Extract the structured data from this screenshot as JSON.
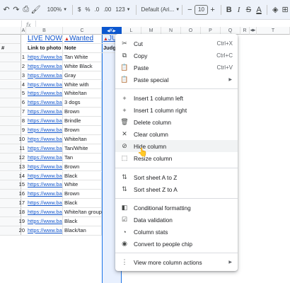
{
  "toolbar": {
    "undo_icon": "undo-icon",
    "redo_icon": "redo-icon",
    "zoom": "100%",
    "currency": "$",
    "percent": "%",
    "dec_dec": ".0",
    "inc_dec": ".00",
    "number_format": "123",
    "font": "Default (Ari...",
    "font_size": "10",
    "bold": "B",
    "italic": "I",
    "strike": "S",
    "text_color": "A"
  },
  "formula": {
    "fx": "fx",
    "value": ""
  },
  "grid": {
    "col_heads": [
      "A",
      "B",
      "C",
      "",
      "K",
      "L",
      "M",
      "N",
      "O",
      "P",
      "Q",
      "R",
      "",
      "T"
    ],
    "header_row": {
      "link": "LIVE NOW",
      "wanted": "Wanted",
      "judging": "JUDGIN"
    },
    "title_row": {
      "hash": "#",
      "link": "Link to photo",
      "note": "Note",
      "judge": "Judg"
    },
    "rows": [
      {
        "n": "1",
        "link": "https://www.back",
        "note": "Tan White"
      },
      {
        "n": "2",
        "link": "https://www.back",
        "note": "White Black"
      },
      {
        "n": "3",
        "link": "https://www.back",
        "note": "Gray"
      },
      {
        "n": "4",
        "link": "https://www.back",
        "note": "White with"
      },
      {
        "n": "5",
        "link": "https://www.back",
        "note": "White/tan"
      },
      {
        "n": "6",
        "link": "https://www.back",
        "note": "3 dogs"
      },
      {
        "n": "7",
        "link": "https://www.back",
        "note": "Brown"
      },
      {
        "n": "8",
        "link": "https://www.back",
        "note": "Brindle"
      },
      {
        "n": "9",
        "link": "https://www.back",
        "note": "Brown"
      },
      {
        "n": "10",
        "link": "https://www.back",
        "note": "White/tan"
      },
      {
        "n": "11",
        "link": "https://www.back",
        "note": "Tan/White"
      },
      {
        "n": "12",
        "link": "https://www.back",
        "note": "Tan"
      },
      {
        "n": "13",
        "link": "https://www.back",
        "note": "Brown"
      },
      {
        "n": "14",
        "link": "https://www.back",
        "note": "Black"
      },
      {
        "n": "15",
        "link": "https://www.back",
        "note": "White"
      },
      {
        "n": "16",
        "link": "https://www.back",
        "note": "Brown"
      },
      {
        "n": "17",
        "link": "https://www.back",
        "note": "Black"
      },
      {
        "n": "18",
        "link": "https://www.back",
        "note": "White/tan group"
      },
      {
        "n": "19",
        "link": "https://www.back",
        "note": "Black"
      },
      {
        "n": "20",
        "link": "https://www.back",
        "note": "Black/tan"
      }
    ]
  },
  "menu": {
    "items": [
      {
        "key": "cut",
        "icon": "✂",
        "label": "Cut",
        "shortcut": "Ctrl+X"
      },
      {
        "key": "copy",
        "icon": "⧉",
        "label": "Copy",
        "shortcut": "Ctrl+C"
      },
      {
        "key": "paste",
        "icon": "📋",
        "label": "Paste",
        "shortcut": "Ctrl+V"
      },
      {
        "key": "paste-special",
        "icon": "📋",
        "label": "Paste special",
        "shortcut": ""
      },
      {
        "key": "insert-left",
        "icon": "+",
        "label": "Insert 1 column left",
        "shortcut": ""
      },
      {
        "key": "insert-right",
        "icon": "+",
        "label": "Insert 1 column right",
        "shortcut": ""
      },
      {
        "key": "delete-column",
        "icon": "🗑",
        "label": "Delete column",
        "shortcut": ""
      },
      {
        "key": "clear-column",
        "icon": "✕",
        "label": "Clear column",
        "shortcut": ""
      },
      {
        "key": "hide-column",
        "icon": "⊘",
        "label": "Hide column",
        "shortcut": ""
      },
      {
        "key": "resize-column",
        "icon": "⬚",
        "label": "Resize column",
        "shortcut": ""
      },
      {
        "key": "sort-a-z",
        "icon": "⇅",
        "label": "Sort sheet A to Z",
        "shortcut": ""
      },
      {
        "key": "sort-z-a",
        "icon": "⇅",
        "label": "Sort sheet Z to A",
        "shortcut": ""
      },
      {
        "key": "conditional-formatting",
        "icon": "◧",
        "label": "Conditional formatting",
        "shortcut": ""
      },
      {
        "key": "data-validation",
        "icon": "☑",
        "label": "Data validation",
        "shortcut": ""
      },
      {
        "key": "column-stats",
        "icon": "◔",
        "label": "Column stats",
        "shortcut": ""
      },
      {
        "key": "people-chip",
        "icon": "◉",
        "label": "Convert to people chip",
        "shortcut": ""
      },
      {
        "key": "more-actions",
        "icon": "⋮",
        "label": "View more column actions",
        "shortcut": ""
      }
    ]
  },
  "colors": {
    "selected_header": "#0b57d0",
    "highlight": "#ffff5c",
    "link": "#1155cc"
  }
}
